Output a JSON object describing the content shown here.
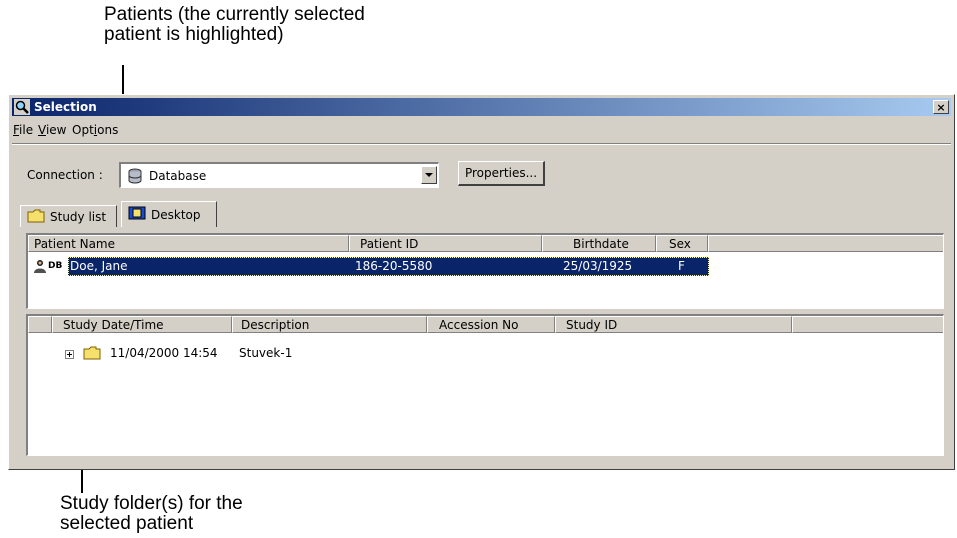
{
  "annotations": {
    "patients_line1": "Patients (the currently selected",
    "patients_line2": "patient is highlighted)",
    "study_line1": "Study folder(s) for the",
    "study_line2": "selected patient"
  },
  "window": {
    "title": "Selection",
    "close": "×"
  },
  "menu": {
    "file": {
      "mnemonic": "F",
      "rest": "ile"
    },
    "view": {
      "mnemonic": "V",
      "rest": "iew"
    },
    "options": {
      "before": "Opt",
      "mnemonic": "i",
      "rest": "ons"
    }
  },
  "connection": {
    "label": "Connection :",
    "value": "Database",
    "icon": "database-icon",
    "properties_button": "Properties..."
  },
  "tabs": [
    {
      "label": "Study list",
      "icon": "folder-icon",
      "active": false
    },
    {
      "label": "Desktop",
      "icon": "desktop-icon",
      "active": true
    }
  ],
  "patients": {
    "columns": [
      "Patient Name",
      "Patient ID",
      "Birthdate",
      "Sex"
    ],
    "rows": [
      {
        "tag": "DB",
        "name": "Doe, Jane",
        "id": "186-20-5580",
        "birthdate": "25/03/1925",
        "sex": "F",
        "selected": true
      }
    ]
  },
  "studies": {
    "columns": [
      "Study Date/Time",
      "Description",
      "Accession No",
      "Study ID"
    ],
    "rows": [
      {
        "datetime": "11/04/2000 14:54",
        "description": "Stuvek-1",
        "accession": "",
        "study_id": ""
      }
    ]
  },
  "colors": {
    "titlebar_start": "#0a246a",
    "titlebar_end": "#a6caf0",
    "selection": "#0a246a",
    "face": "#d4d0c8",
    "folder": "#f5e06b"
  }
}
